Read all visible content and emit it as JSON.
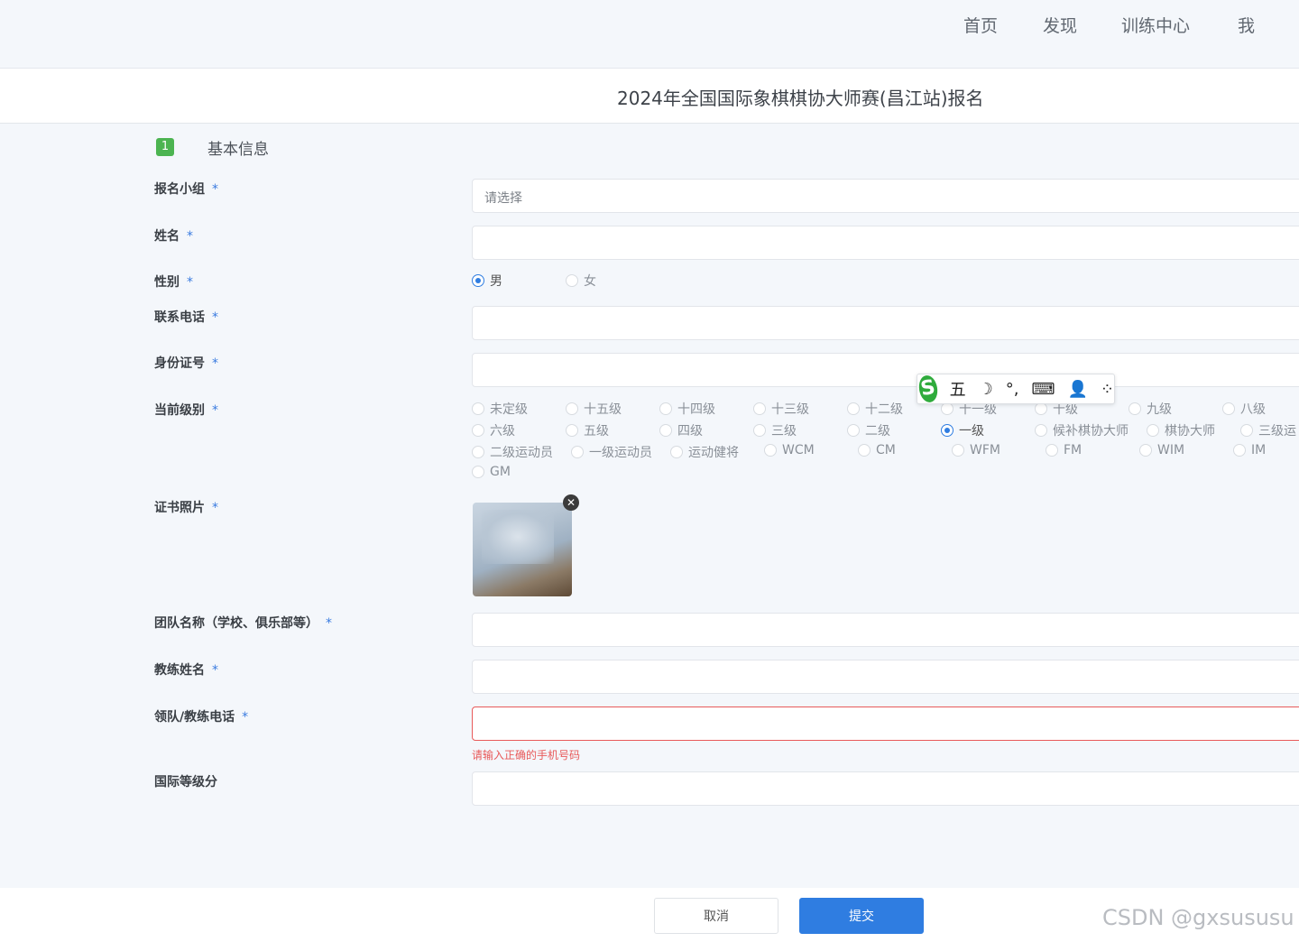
{
  "nav": {
    "home": "首页",
    "discover": "发现",
    "training": "训练中心",
    "me": "我"
  },
  "page_title": "2024年全国国际象棋棋协大师赛(昌江站)报名",
  "section": {
    "step": "1",
    "title": "基本信息"
  },
  "fields": {
    "group": {
      "label": "报名小组",
      "placeholder": "请选择"
    },
    "name": {
      "label": "姓名"
    },
    "gender": {
      "label": "性别",
      "options": [
        "男",
        "女"
      ],
      "selected": "男"
    },
    "phone": {
      "label": "联系电话"
    },
    "id_number": {
      "label": "身份证号"
    },
    "level": {
      "label": "当前级别",
      "options": [
        "未定级",
        "十五级",
        "十四级",
        "十三级",
        "十二级",
        "十一级",
        "十级",
        "九级",
        "八级",
        "六级",
        "五级",
        "四级",
        "三级",
        "二级",
        "一级",
        "候补棋协大师",
        "棋协大师",
        "三级运",
        "二级运动员",
        "一级运动员",
        "运动健将",
        "WCM",
        "CM",
        "WFM",
        "FM",
        "WIM",
        "IM",
        "GM"
      ],
      "selected": "一级"
    },
    "certificate": {
      "label": "证书照片"
    },
    "team": {
      "label": "团队名称（学校、俱乐部等）"
    },
    "coach": {
      "label": "教练姓名"
    },
    "coach_phone": {
      "label": "领队/教练电话",
      "error": "请输入正确的手机号码"
    },
    "rating": {
      "label": "国际等级分"
    }
  },
  "required_mark": "*",
  "ime": {
    "logo": "S",
    "mode": "五",
    "items": [
      "☽",
      "°,",
      "⌨",
      "👤",
      "⁘"
    ]
  },
  "buttons": {
    "cancel": "取消",
    "submit": "提交"
  },
  "watermark": "CSDN @gxsususu",
  "colors": {
    "primary": "#2f7de1",
    "error": "#e85a5a",
    "step": "#4cb451"
  }
}
